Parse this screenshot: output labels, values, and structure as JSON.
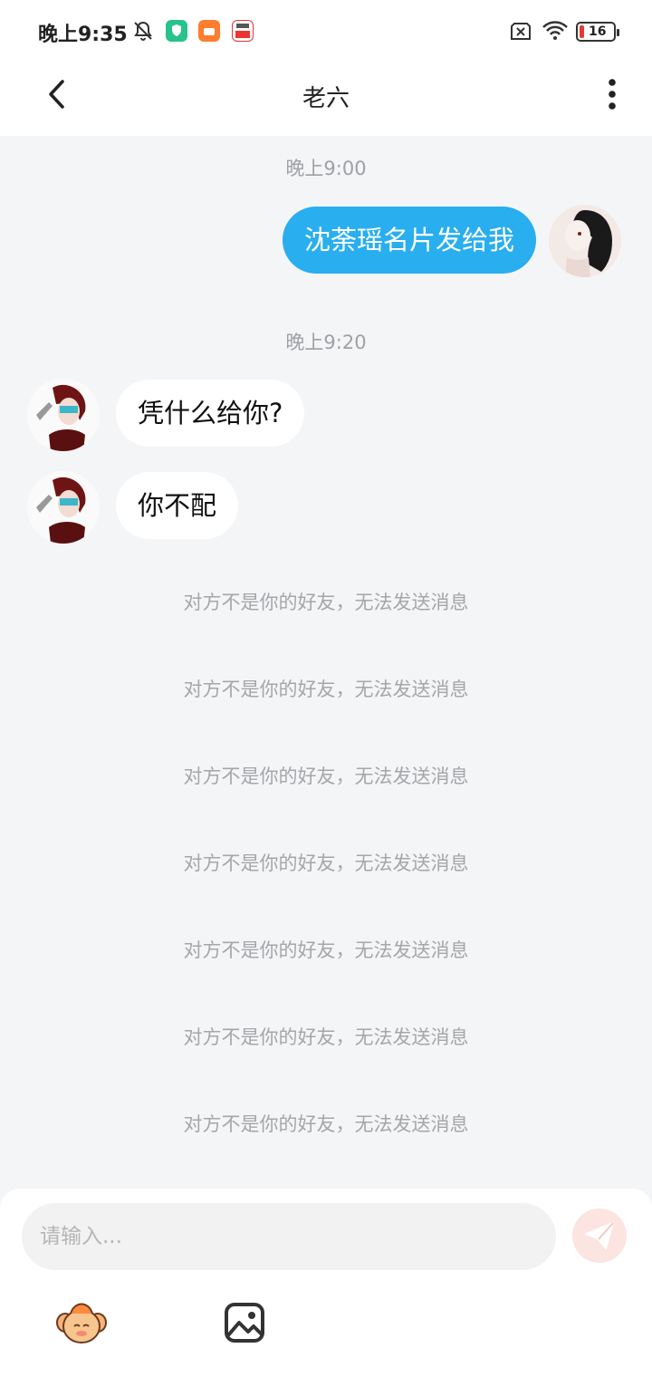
{
  "status_bar": {
    "time": "晚上9:35",
    "battery": "16",
    "icons": [
      "bell-off-icon",
      "shield-app-icon",
      "orange-app-icon",
      "news-app-icon",
      "sim-off-icon",
      "wifi-icon",
      "battery-icon"
    ]
  },
  "header": {
    "title": "老六",
    "back_icon": "chevron-left-icon",
    "more_icon": "more-vertical-icon"
  },
  "chat": {
    "messages": [
      {
        "timestamp": "晚上9:00",
        "direction": "outgoing",
        "text": "沈荼瑶名片发给我"
      },
      {
        "timestamp": "晚上9:20",
        "direction": "incoming",
        "text": "凭什么给你?"
      },
      {
        "direction": "incoming",
        "text": "你不配"
      }
    ],
    "system_notices": [
      "对方不是你的好友，无法发送消息",
      "对方不是你的好友，无法发送消息",
      "对方不是你的好友，无法发送消息",
      "对方不是你的好友，无法发送消息",
      "对方不是你的好友，无法发送消息",
      "对方不是你的好友，无法发送消息",
      "对方不是你的好友，无法发送消息"
    ]
  },
  "composer": {
    "placeholder": "请输入...",
    "value": "",
    "send_icon": "send-icon",
    "tools": [
      "emoji-mascot-icon",
      "image-icon"
    ]
  },
  "colors": {
    "accent": "#29aef0",
    "background": "#f4f5f7",
    "send_button": "#fce4e0"
  }
}
